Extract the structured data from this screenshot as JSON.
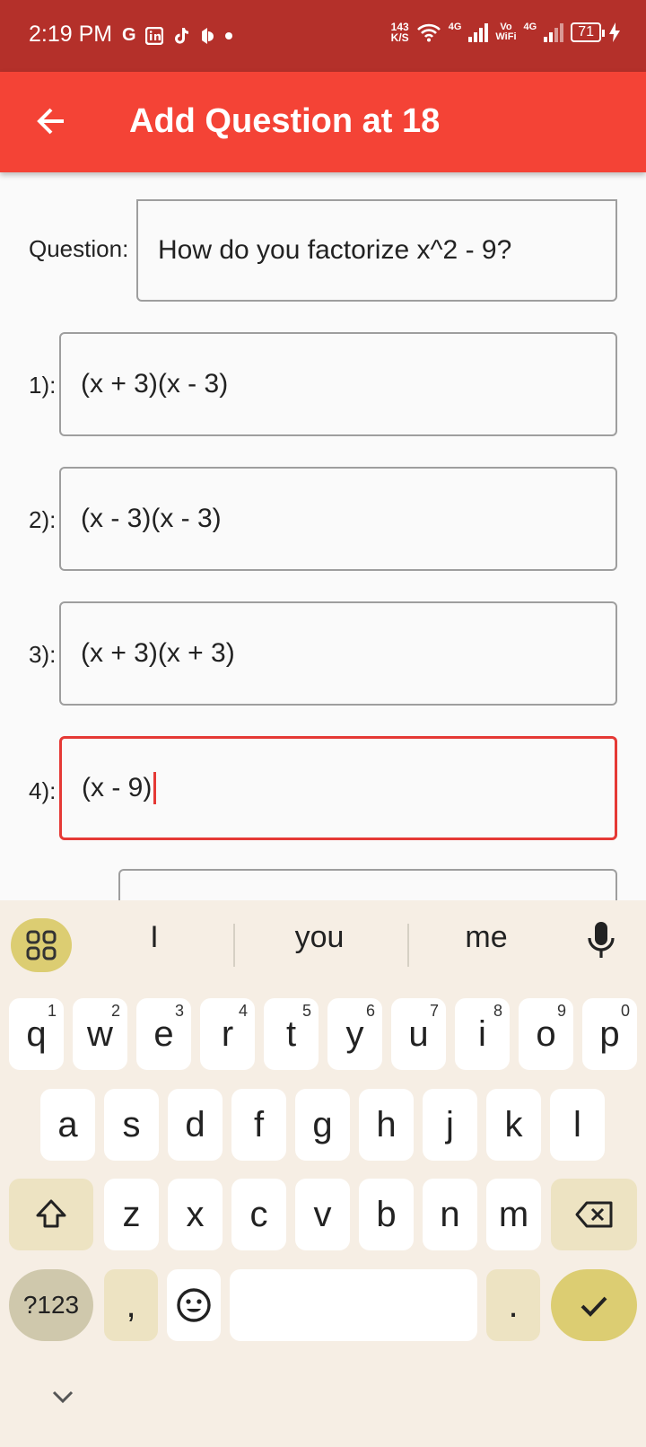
{
  "status_bar": {
    "time": "2:19 PM",
    "netspeed_value": "143",
    "netspeed_unit": "K/S",
    "sig1_label": "4G",
    "vowifi_top": "Vo",
    "vowifi_bottom": "WiFi",
    "sig2_label": "4G",
    "battery": "71",
    "icons": [
      "g-icon",
      "linkedin-icon",
      "tiktok-icon",
      "app-icon",
      "dot-icon",
      "wifi-icon",
      "signal-icon",
      "charging-icon"
    ]
  },
  "app_bar": {
    "title": "Add Question at 18",
    "back_icon": "arrow-back-icon"
  },
  "form": {
    "question_label": "Question:",
    "question_value": "How do you factorize x^2 - 9?",
    "options": [
      {
        "label": "1):",
        "value": "(x + 3)(x - 3)"
      },
      {
        "label": "2):",
        "value": "(x - 3)(x - 3)"
      },
      {
        "label": "3):",
        "value": "(x + 3)(x + 3)"
      },
      {
        "label": "4):",
        "value": "(x - 9)"
      }
    ]
  },
  "keyboard": {
    "suggestions": [
      "I",
      "you",
      "me"
    ],
    "row1": [
      {
        "k": "q",
        "n": "1"
      },
      {
        "k": "w",
        "n": "2"
      },
      {
        "k": "e",
        "n": "3"
      },
      {
        "k": "r",
        "n": "4"
      },
      {
        "k": "t",
        "n": "5"
      },
      {
        "k": "y",
        "n": "6"
      },
      {
        "k": "u",
        "n": "7"
      },
      {
        "k": "i",
        "n": "8"
      },
      {
        "k": "o",
        "n": "9"
      },
      {
        "k": "p",
        "n": "0"
      }
    ],
    "row2": [
      "a",
      "s",
      "d",
      "f",
      "g",
      "h",
      "j",
      "k",
      "l"
    ],
    "row3": [
      "z",
      "x",
      "c",
      "v",
      "b",
      "n",
      "m"
    ],
    "symbols_label": "?123",
    "comma": ",",
    "period": "."
  },
  "colors": {
    "status_bar": "#b4302a",
    "app_bar": "#f44336",
    "focus_border": "#e53935",
    "keyboard_bg": "#f6eee4",
    "accent_key": "#dccd72"
  }
}
